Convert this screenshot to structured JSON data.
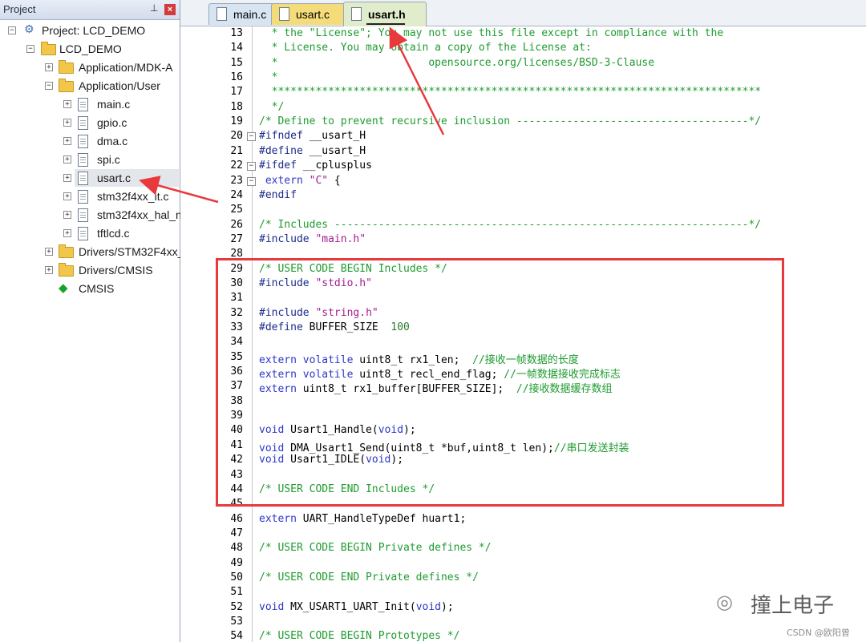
{
  "panel": {
    "title": "Project"
  },
  "tree": [
    {
      "label": "Project: LCD_DEMO",
      "kind": "project",
      "expander": "⊟"
    },
    {
      "label": "LCD_DEMO",
      "kind": "target",
      "expander": "⊟"
    },
    {
      "label": "Application/MDK-A",
      "kind": "folder",
      "expander": "+"
    },
    {
      "label": "Application/User",
      "kind": "folder",
      "expander": "−"
    },
    {
      "label": "main.c",
      "kind": "file",
      "expander": "+"
    },
    {
      "label": "gpio.c",
      "kind": "file",
      "expander": "+"
    },
    {
      "label": "dma.c",
      "kind": "file",
      "expander": "+"
    },
    {
      "label": "spi.c",
      "kind": "file",
      "expander": "+"
    },
    {
      "label": "usart.c",
      "kind": "file",
      "expander": "+",
      "selected": true
    },
    {
      "label": "stm32f4xx_it.c",
      "kind": "file",
      "expander": "+"
    },
    {
      "label": "stm32f4xx_hal_n",
      "kind": "file",
      "expander": "+"
    },
    {
      "label": "tftlcd.c",
      "kind": "file",
      "expander": "+"
    },
    {
      "label": "Drivers/STM32F4xx_",
      "kind": "folder",
      "expander": "+"
    },
    {
      "label": "Drivers/CMSIS",
      "kind": "folder",
      "expander": "+"
    },
    {
      "label": "CMSIS",
      "kind": "component",
      "expander": ""
    }
  ],
  "tabs": [
    {
      "label": "main.c"
    },
    {
      "label": "usart.c"
    },
    {
      "label": "usart.h",
      "active": true
    }
  ],
  "code_lines": [
    {
      "n": "13",
      "segs": [
        [
          "c",
          "  * the \"License\"; You may not use this file except in compliance with the"
        ]
      ]
    },
    {
      "n": "14",
      "segs": [
        [
          "c",
          "  * License. You may obtain a copy of the License at:"
        ]
      ]
    },
    {
      "n": "15",
      "segs": [
        [
          "c",
          "  *                        opensource.org/licenses/BSD-3-Clause"
        ]
      ]
    },
    {
      "n": "16",
      "segs": [
        [
          "c",
          "  *"
        ]
      ]
    },
    {
      "n": "17",
      "segs": [
        [
          "c",
          "  ******************************************************************************"
        ]
      ]
    },
    {
      "n": "18",
      "segs": [
        [
          "c",
          "  */"
        ]
      ]
    },
    {
      "n": "19",
      "segs": [
        [
          "c",
          "/* Define to prevent recursive inclusion -------------------------------------*/"
        ]
      ]
    },
    {
      "n": "20",
      "segs": [
        [
          "p",
          "#ifndef "
        ],
        [
          "t",
          "__usart_H"
        ]
      ],
      "fold": "−"
    },
    {
      "n": "21",
      "segs": [
        [
          "p",
          "#define "
        ],
        [
          "t",
          "__usart_H"
        ]
      ]
    },
    {
      "n": "22",
      "segs": [
        [
          "p",
          "#ifdef "
        ],
        [
          "t",
          "__cplusplus"
        ]
      ],
      "fold": "−"
    },
    {
      "n": "23",
      "segs": [
        [
          "k",
          " extern "
        ],
        [
          "s",
          "\"C\""
        ],
        [
          "t",
          " {"
        ]
      ],
      "fold": "−"
    },
    {
      "n": "24",
      "segs": [
        [
          "p",
          "#endif"
        ]
      ]
    },
    {
      "n": "25",
      "segs": []
    },
    {
      "n": "26",
      "segs": [
        [
          "c",
          "/* Includes ------------------------------------------------------------------*/"
        ]
      ]
    },
    {
      "n": "27",
      "segs": [
        [
          "p",
          "#include "
        ],
        [
          "s",
          "\"main.h\""
        ]
      ]
    },
    {
      "n": "28",
      "segs": []
    },
    {
      "n": "29",
      "segs": [
        [
          "c",
          "/* USER CODE BEGIN Includes */"
        ]
      ]
    },
    {
      "n": "30",
      "segs": [
        [
          "p",
          "#include "
        ],
        [
          "s",
          "\"stdio.h\""
        ]
      ]
    },
    {
      "n": "31",
      "segs": []
    },
    {
      "n": "32",
      "segs": [
        [
          "p",
          "#include "
        ],
        [
          "s",
          "\"string.h\""
        ]
      ]
    },
    {
      "n": "33",
      "segs": [
        [
          "p",
          "#define "
        ],
        [
          "t",
          "BUFFER_SIZE  "
        ],
        [
          "n",
          "100"
        ]
      ]
    },
    {
      "n": "34",
      "segs": []
    },
    {
      "n": "35",
      "segs": [
        [
          "k",
          "extern volatile "
        ],
        [
          "t",
          "uint8_t rx1_len;  "
        ],
        [
          "c",
          "//接收一帧数据的长度"
        ]
      ]
    },
    {
      "n": "36",
      "segs": [
        [
          "k",
          "extern volatile "
        ],
        [
          "t",
          "uint8_t recl_end_flag; "
        ],
        [
          "c",
          "//一帧数据接收完成标志"
        ]
      ]
    },
    {
      "n": "37",
      "segs": [
        [
          "k",
          "extern "
        ],
        [
          "t",
          "uint8_t rx1_buffer[BUFFER_SIZE];  "
        ],
        [
          "c",
          "//接收数据缓存数组"
        ]
      ]
    },
    {
      "n": "38",
      "segs": []
    },
    {
      "n": "39",
      "segs": []
    },
    {
      "n": "40",
      "segs": [
        [
          "k",
          "void "
        ],
        [
          "t",
          "Usart1_Handle("
        ],
        [
          "k",
          "void"
        ],
        [
          "t",
          ");"
        ]
      ]
    },
    {
      "n": "41",
      "segs": [
        [
          "k",
          "void "
        ],
        [
          "t",
          "DMA_Usart1_Send(uint8_t *buf,uint8_t len);"
        ],
        [
          "c",
          "//串口发送封装"
        ]
      ]
    },
    {
      "n": "42",
      "segs": [
        [
          "k",
          "void "
        ],
        [
          "t",
          "Usart1_IDLE("
        ],
        [
          "k",
          "void"
        ],
        [
          "t",
          ");"
        ]
      ]
    },
    {
      "n": "43",
      "segs": []
    },
    {
      "n": "44",
      "segs": [
        [
          "c",
          "/* USER CODE END Includes */"
        ]
      ]
    },
    {
      "n": "45",
      "segs": []
    },
    {
      "n": "46",
      "segs": [
        [
          "k",
          "extern "
        ],
        [
          "t",
          "UART_HandleTypeDef huart1;"
        ]
      ]
    },
    {
      "n": "47",
      "segs": []
    },
    {
      "n": "48",
      "segs": [
        [
          "c",
          "/* USER CODE BEGIN Private defines */"
        ]
      ]
    },
    {
      "n": "49",
      "segs": []
    },
    {
      "n": "50",
      "segs": [
        [
          "c",
          "/* USER CODE END Private defines */"
        ]
      ]
    },
    {
      "n": "51",
      "segs": []
    },
    {
      "n": "52",
      "segs": [
        [
          "k",
          "void "
        ],
        [
          "t",
          "MX_USART1_UART_Init("
        ],
        [
          "k",
          "void"
        ],
        [
          "t",
          ");"
        ]
      ]
    },
    {
      "n": "53",
      "segs": []
    },
    {
      "n": "54",
      "segs": [
        [
          "c",
          "/* USER CODE BEGIN Prototypes */"
        ]
      ]
    }
  ],
  "watermark": {
    "text": "撞上电子",
    "logo_icon": "wechat-icon",
    "source": "CSDN @欧阳曾"
  },
  "colors": {
    "comment": "#1e9b2f",
    "keyword": "#2b36c8",
    "string": "#a31c8f",
    "highlight": "#e8393c"
  }
}
